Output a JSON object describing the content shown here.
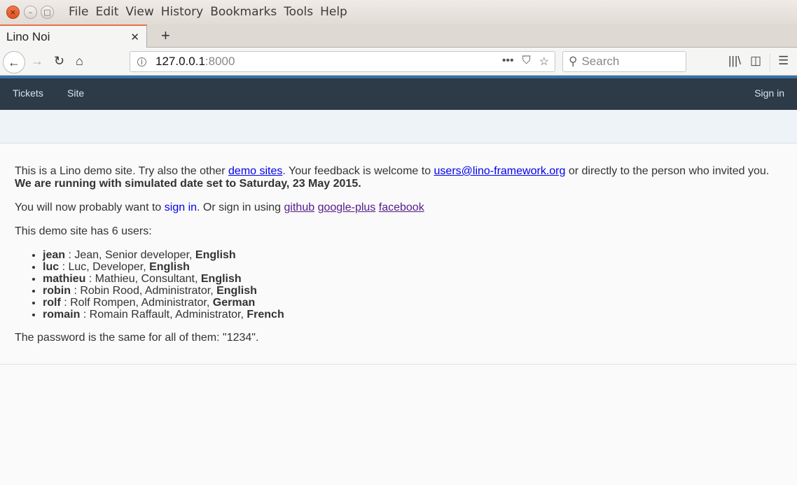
{
  "window": {
    "menu": [
      "File",
      "Edit",
      "View",
      "History",
      "Bookmarks",
      "Tools",
      "Help"
    ]
  },
  "tab": {
    "title": "Lino Noi"
  },
  "urlbar": {
    "host": "127.0.0.1",
    "port": ":8000"
  },
  "search": {
    "placeholder": "Search"
  },
  "appnav": {
    "left": [
      "Tickets",
      "Site"
    ],
    "right": "Sign in"
  },
  "content": {
    "p1a": "This is a Lino demo site. Try also the other ",
    "p1link": "demo sites",
    "p1b": ". Your feedback is welcome to ",
    "p1email": "users@lino-framework.org",
    "p1c": " or directly to the person who invited you.",
    "p1bold": "We are running with simulated date set to Saturday, 23 May 2015.",
    "p2a": "You will now probably want to ",
    "p2link": "sign in",
    "p2b": ". Or sign in using ",
    "social": [
      "github",
      "google-plus",
      "facebook"
    ],
    "p3": "This demo site has 6 users:",
    "users": [
      {
        "name": "jean",
        "desc": " : Jean, Senior developer, ",
        "lang": "English"
      },
      {
        "name": "luc",
        "desc": " : Luc, Developer, ",
        "lang": "English"
      },
      {
        "name": "mathieu",
        "desc": " : Mathieu, Consultant, ",
        "lang": "English"
      },
      {
        "name": "robin",
        "desc": " : Robin Rood, Administrator, ",
        "lang": "English"
      },
      {
        "name": "rolf",
        "desc": " : Rolf Rompen, Administrator, ",
        "lang": "German"
      },
      {
        "name": "romain",
        "desc": " : Romain Raffault, Administrator, ",
        "lang": "French"
      }
    ],
    "p4": "The password is the same for all of them: \"1234\"."
  },
  "colors": {
    "navbar": "#2d3a47",
    "accent": "#3572a5",
    "link": "#0000ee",
    "visited": "#551a8b"
  }
}
